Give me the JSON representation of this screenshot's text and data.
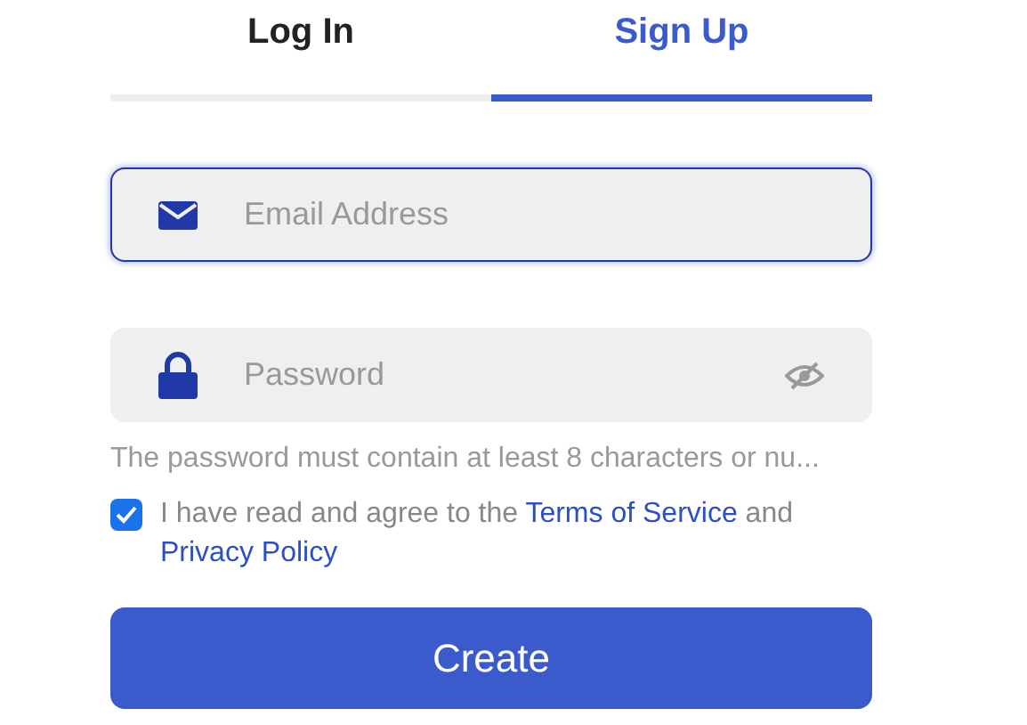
{
  "tabs": [
    {
      "label": "Log In",
      "selected": false
    },
    {
      "label": "Sign Up",
      "selected": true
    }
  ],
  "fields": [
    {
      "kind": "email",
      "placeholder": "Email Address",
      "focused": true
    },
    {
      "kind": "password",
      "placeholder": "Password",
      "focused": false
    }
  ],
  "hint": "The password must contain at least 8 characters or nu...",
  "agreement": {
    "checked": true,
    "text": "I have read and agree to the ",
    "link1": "Terms of Service",
    "middle": " and ",
    "link2": "Privacy Policy"
  },
  "button": "Create"
}
